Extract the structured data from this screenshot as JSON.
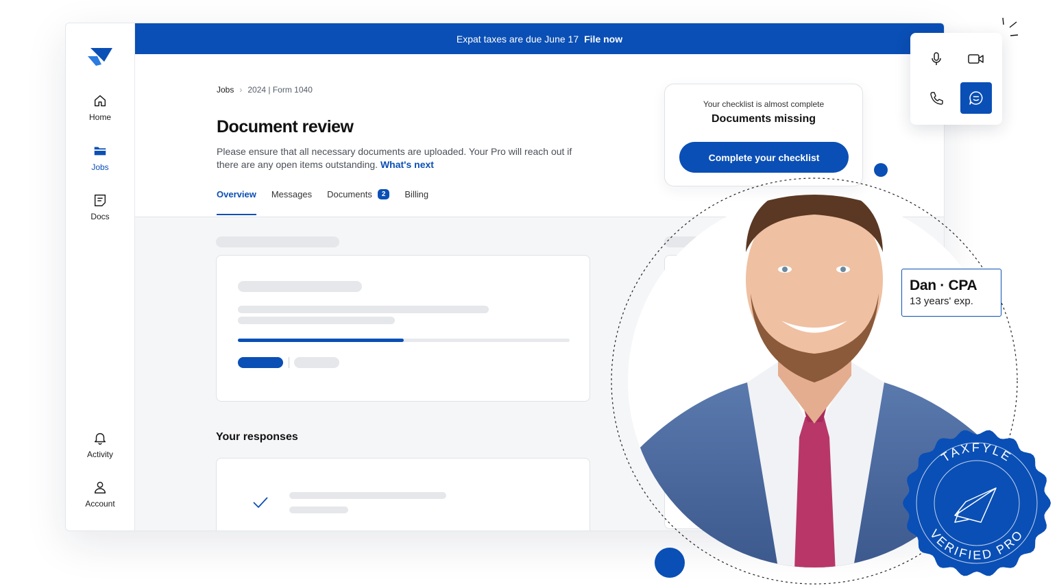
{
  "banner": {
    "text": "Expat taxes are due June 17",
    "link": "File now"
  },
  "sidebar": {
    "items": [
      {
        "label": "Home",
        "icon": "home-icon"
      },
      {
        "label": "Jobs",
        "icon": "folder-icon",
        "active": true
      },
      {
        "label": "Docs",
        "icon": "document-icon"
      },
      {
        "label": "Activity",
        "icon": "bell-icon"
      },
      {
        "label": "Account",
        "icon": "user-icon"
      }
    ]
  },
  "breadcrumb": {
    "root": "Jobs",
    "current": "2024 | Form 1040"
  },
  "page": {
    "title": "Document review",
    "description": "Please ensure that all necessary documents are uploaded. Your Pro will reach out if there are any open items outstanding.",
    "description_link": "What's next"
  },
  "tabs": [
    {
      "label": "Overview",
      "active": true
    },
    {
      "label": "Messages"
    },
    {
      "label": "Documents",
      "badge": "2"
    },
    {
      "label": "Billing"
    }
  ],
  "progress": {
    "fraction": 0.5
  },
  "responses": {
    "title": "Your responses"
  },
  "checklist": {
    "subtitle": "Your checklist is almost complete",
    "title": "Documents missing",
    "button": "Complete your checklist"
  },
  "communication": {
    "buttons": [
      "microphone-icon",
      "video-camera-icon",
      "phone-icon",
      "chat-icon"
    ],
    "active": "chat-icon"
  },
  "pro": {
    "name": "Dan · CPA",
    "experience": "13 years' exp."
  },
  "seal": {
    "top_text": "TAXFYLE",
    "bottom_text": "VERIFIED PRO"
  },
  "colors": {
    "brand": "#0a4fb5",
    "skeleton": "#e6e7ea",
    "background": "#f5f6f8"
  }
}
